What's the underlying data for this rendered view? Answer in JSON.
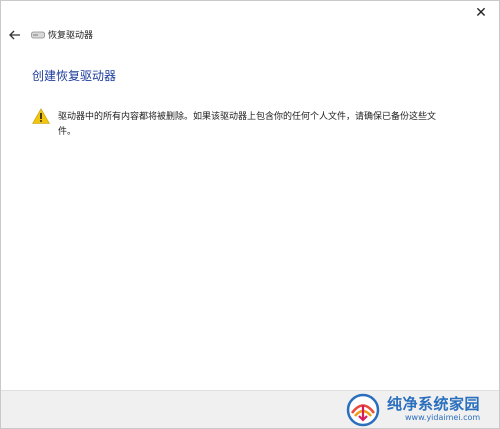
{
  "window": {
    "close_glyph": "✕"
  },
  "header": {
    "back_icon": "back-arrow-icon",
    "drive_icon": "drive-icon",
    "title": "恢复驱动器"
  },
  "main": {
    "heading": "创建恢复驱动器",
    "warning_icon": "warning-icon",
    "warning_text": "驱动器中的所有内容都将被删除。如果该驱动器上包含你的任何个人文件，请确保已备份这些文件。"
  },
  "watermark": {
    "site_name": "纯净系统家园",
    "url": "www.yidaimei.com"
  },
  "colors": {
    "heading": "#1d3c9c",
    "warning_yellow": "#f1c40f",
    "footer_bg": "#f0f0f0",
    "watermark_blue": "#2a6fbd"
  }
}
